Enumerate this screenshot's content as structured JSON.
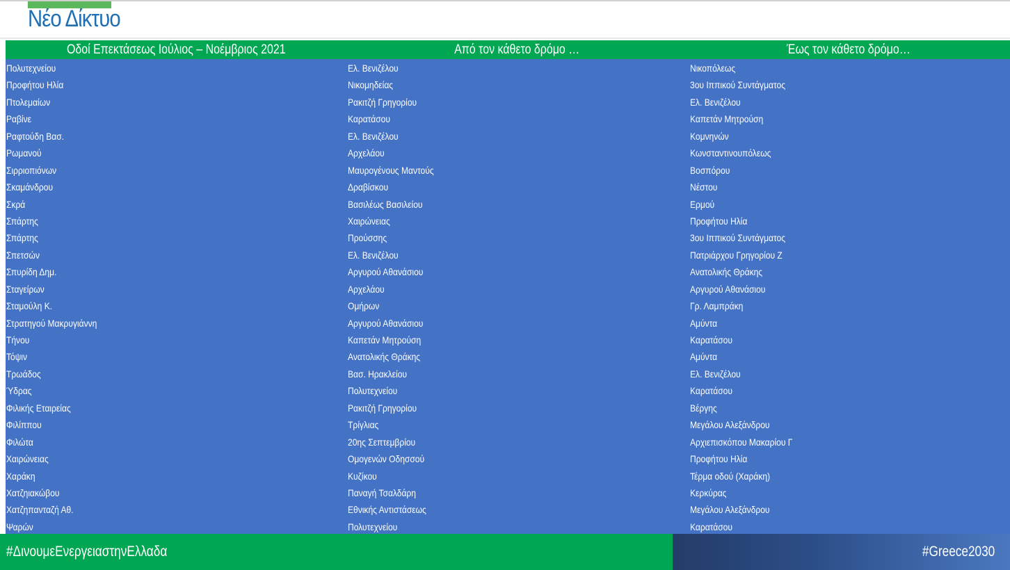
{
  "title": "Νέο Δίκτυο",
  "table": {
    "headers": [
      "Οδοί Επεκτάσεως Ιούλιος – Νοέμβριος 2021",
      "Από τον κάθετο δρόμο …",
      "Έως τον κάθετο δρόμο…"
    ],
    "rows": [
      [
        "Πολυτεχνείου",
        "Ελ. Βενιζέλου",
        "Νικοπόλεως"
      ],
      [
        "Προφήτου Ηλία",
        "Νικομηδείας",
        "3ου Ιππικού Συντάγματος"
      ],
      [
        "Πτολεμαίων",
        "Ρακιτζή Γρηγορίου",
        "Ελ. Βενιζέλου"
      ],
      [
        "Ραβίνε",
        "Καρατάσου",
        "Καπετάν Μητρούση"
      ],
      [
        "Ραφτούδη Βασ.",
        "Ελ. Βενιζέλου",
        "Κομνηνών"
      ],
      [
        "Ρωμανού",
        "Αρχελάου",
        "Κωνσταντινουπόλεως"
      ],
      [
        "Σιρριοπιόνων",
        "Μαυρογένους Μαντούς",
        "Βοσπόρου"
      ],
      [
        "Σκαμάνδρου",
        "Δραβίσκου",
        "Νέστου"
      ],
      [
        "Σκρά",
        "Βασιλέως Βασιλείου",
        "Ερμού"
      ],
      [
        "Σπάρτης",
        "Χαιρώνειας",
        "Προφήτου Ηλία"
      ],
      [
        "Σπάρτης",
        "Προύσσης",
        "3ου Ιππικού Συντάγματος"
      ],
      [
        "Σπετσών",
        "Ελ. Βενιζέλου",
        "Πατριάρχου Γρηγορίου Ζ"
      ],
      [
        "Σπυρίδη Δημ.",
        "Αργυρού Αθανάσιου",
        "Ανατολικής Θράκης"
      ],
      [
        "Σταγείρων",
        "Αρχελάου",
        "Αργυρού Αθανάσιου"
      ],
      [
        "Σταμούλη Κ.",
        "Ομήρων",
        "Γρ. Λαμπράκη"
      ],
      [
        "Στρατηγού Μακρυγιάννη",
        "Αργυρού Αθανάσιου",
        "Αμύντα"
      ],
      [
        "Τήνου",
        "Καπετάν Μητρούση",
        "Καρατάσου"
      ],
      [
        "Τόψιν",
        "Ανατολικής Θράκης",
        "Αμύντα"
      ],
      [
        "Τρωάδος",
        "Βασ. Ηρακλείου",
        "Ελ. Βενιζέλου"
      ],
      [
        "Ύδρας",
        "Πολυτεχνείου",
        "Καρατάσου"
      ],
      [
        "Φιλικής Εταιρείας",
        "Ρακιτζή Γρηγορίου",
        "Βέργης"
      ],
      [
        "Φιλίππου",
        "Τρίγλιας",
        "Μεγάλου Αλεξάνδρου"
      ],
      [
        "Φιλώτα",
        "20ης Σεπτεμβρίου",
        "Αρχιεπισκόπου Μακαρίου Γ"
      ],
      [
        "Χαιρώνειας",
        "Ομογενών Οδησσού",
        "Προφήτου Ηλία"
      ],
      [
        "Χαράκη",
        "Κυζίκου",
        "Τέρμα οδού (Χαράκη)"
      ],
      [
        "Χατζηιακώβου",
        "Παναγή Τσαλδάρη",
        "Κερκύρας"
      ],
      [
        "Χατζηπανταζή Αθ.",
        "Εθνικής Αντιστάσεως",
        "Μεγάλου Αλεξάνδρου"
      ],
      [
        "Ψαρών",
        "Πολυτεχνείου",
        "Καρατάσου"
      ]
    ]
  },
  "footer": {
    "left_hashtag": "#ΔινουμεΕνεργειαστηνΕλλαδα",
    "right_hashtag": "#Greece2030"
  },
  "colors": {
    "title": "#1f6fb2",
    "accent_green": "#00a651",
    "table_blue": "#4472c4",
    "footer_navy": "#243c68"
  }
}
